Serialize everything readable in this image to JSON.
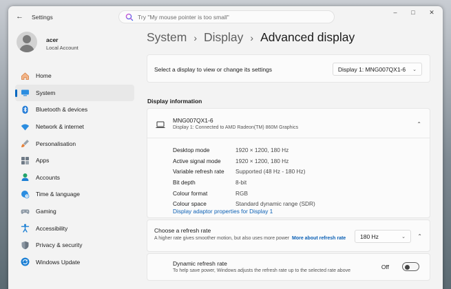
{
  "window": {
    "title": "Settings"
  },
  "search": {
    "placeholder": "Try \"My mouse pointer is too small\""
  },
  "profile": {
    "name": "acer",
    "account_type": "Local Account"
  },
  "sidebar": {
    "items": [
      {
        "label": "Home",
        "icon": "home-icon"
      },
      {
        "label": "System",
        "icon": "system-icon",
        "active": true
      },
      {
        "label": "Bluetooth & devices",
        "icon": "bluetooth-icon"
      },
      {
        "label": "Network & internet",
        "icon": "wifi-icon"
      },
      {
        "label": "Personalisation",
        "icon": "brush-icon"
      },
      {
        "label": "Apps",
        "icon": "apps-icon"
      },
      {
        "label": "Accounts",
        "icon": "accounts-icon"
      },
      {
        "label": "Time & language",
        "icon": "globe-clock-icon"
      },
      {
        "label": "Gaming",
        "icon": "gamepad-icon"
      },
      {
        "label": "Accessibility",
        "icon": "accessibility-icon"
      },
      {
        "label": "Privacy & security",
        "icon": "shield-icon"
      },
      {
        "label": "Windows Update",
        "icon": "update-icon"
      }
    ]
  },
  "breadcrumb": {
    "level1": "System",
    "level2": "Display",
    "current": "Advanced display"
  },
  "display_selector": {
    "label": "Select a display to view or change its settings",
    "selected": "Display 1: MNG007QX1-6"
  },
  "display_info": {
    "heading": "Display information",
    "monitor_name": "MNG007QX1-6",
    "monitor_sub": "Display 1: Connected to AMD Radeon(TM) 860M Graphics",
    "rows": [
      {
        "key": "Desktop mode",
        "value": "1920 × 1200, 180 Hz"
      },
      {
        "key": "Active signal mode",
        "value": "1920 × 1200, 180 Hz"
      },
      {
        "key": "Variable refresh rate",
        "value": "Supported (48 Hz - 180 Hz)"
      },
      {
        "key": "Bit depth",
        "value": "8-bit"
      },
      {
        "key": "Colour format",
        "value": "RGB"
      },
      {
        "key": "Colour space",
        "value": "Standard dynamic range (SDR)"
      }
    ],
    "adapter_link": "Display adaptor properties for Display 1"
  },
  "refresh_rate": {
    "title": "Choose a refresh rate",
    "desc": "A higher rate gives smoother motion, but also uses more power",
    "more_link": "More about refresh rate",
    "selected": "180 Hz"
  },
  "dynamic_refresh": {
    "title": "Dynamic refresh rate",
    "desc": "To help save power, Windows adjusts the refresh rate up to the selected rate above",
    "state": "Off"
  },
  "colors": {
    "accent": "#0067c0",
    "link": "#0a5fb4",
    "background": "#f3f3f3"
  }
}
